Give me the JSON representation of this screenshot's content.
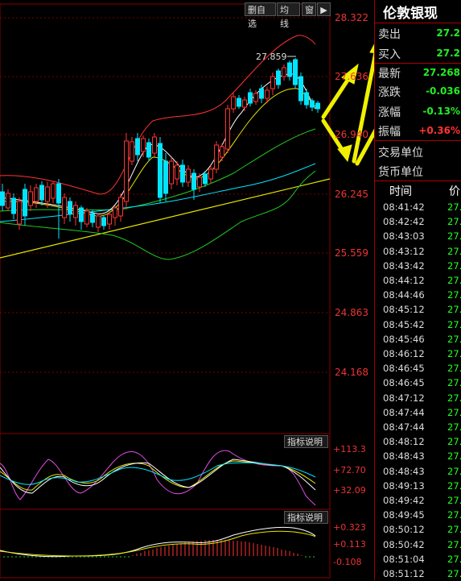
{
  "toolbar": {
    "del_watch": "删自选",
    "ma_line": "均线",
    "window": "窗"
  },
  "price_axis": [
    "28.322",
    "27.636",
    "26.940",
    "26.245",
    "25.559",
    "24.863",
    "24.168"
  ],
  "peak_label": "27.859",
  "indicator1": {
    "button": "指标说明",
    "axis": [
      "+113.3",
      "+72.70",
      "+32.09"
    ]
  },
  "indicator2": {
    "button": "指标说明",
    "axis": [
      "+0.323",
      "+0.113",
      "-0.108"
    ]
  },
  "quote": {
    "title": "伦敦银现",
    "rows": [
      {
        "label": "卖出",
        "value": "27.2",
        "color": "#22ee22"
      },
      {
        "label": "买入",
        "value": "27.2",
        "color": "#22ee22"
      },
      {
        "label": "最新",
        "value": "27.268",
        "color": "#22ee22"
      },
      {
        "label": "涨跌",
        "value": "-0.036",
        "color": "#22ee22"
      },
      {
        "label": "涨幅",
        "value": "-0.13%",
        "color": "#22ee22"
      },
      {
        "label": "振幅",
        "value": "+0.36%",
        "color": "#ff3333"
      },
      {
        "label": "交易单位",
        "value": "",
        "color": "#ffffff"
      },
      {
        "label": "货币单位",
        "value": "",
        "color": "#ffffff"
      }
    ]
  },
  "ticks": {
    "header_time": "时间",
    "header_price": "价",
    "rows": [
      {
        "time": "08:41:42",
        "price": "27."
      },
      {
        "time": "08:42:42",
        "price": "27."
      },
      {
        "time": "08:43:03",
        "price": "27."
      },
      {
        "time": "08:43:12",
        "price": "27."
      },
      {
        "time": "08:43:42",
        "price": "27."
      },
      {
        "time": "08:44:12",
        "price": "27."
      },
      {
        "time": "08:44:46",
        "price": "27."
      },
      {
        "time": "08:45:12",
        "price": "27."
      },
      {
        "time": "08:45:42",
        "price": "27."
      },
      {
        "time": "08:45:46",
        "price": "27."
      },
      {
        "time": "08:46:12",
        "price": "27."
      },
      {
        "time": "08:46:45",
        "price": "27."
      },
      {
        "time": "08:46:45",
        "price": "27."
      },
      {
        "time": "08:47:12",
        "price": "27."
      },
      {
        "time": "08:47:44",
        "price": "27."
      },
      {
        "time": "08:47:44",
        "price": "27."
      },
      {
        "time": "08:48:12",
        "price": "27."
      },
      {
        "time": "08:48:43",
        "price": "27."
      },
      {
        "time": "08:48:43",
        "price": "27."
      },
      {
        "time": "08:49:13",
        "price": "27."
      },
      {
        "time": "08:49:42",
        "price": "27."
      },
      {
        "time": "08:49:45",
        "price": "27."
      },
      {
        "time": "08:50:12",
        "price": "27."
      },
      {
        "time": "08:50:42",
        "price": "27."
      },
      {
        "time": "08:51:04",
        "price": "27."
      },
      {
        "time": "08:51:12",
        "price": "27."
      }
    ]
  },
  "colors": {
    "up": "#ff3333",
    "down": "#00e5ff",
    "grid": "#7a0000",
    "ma_white": "#ffffff",
    "ma_yellow": "#e6e600",
    "arrow": "#f0f000"
  }
}
